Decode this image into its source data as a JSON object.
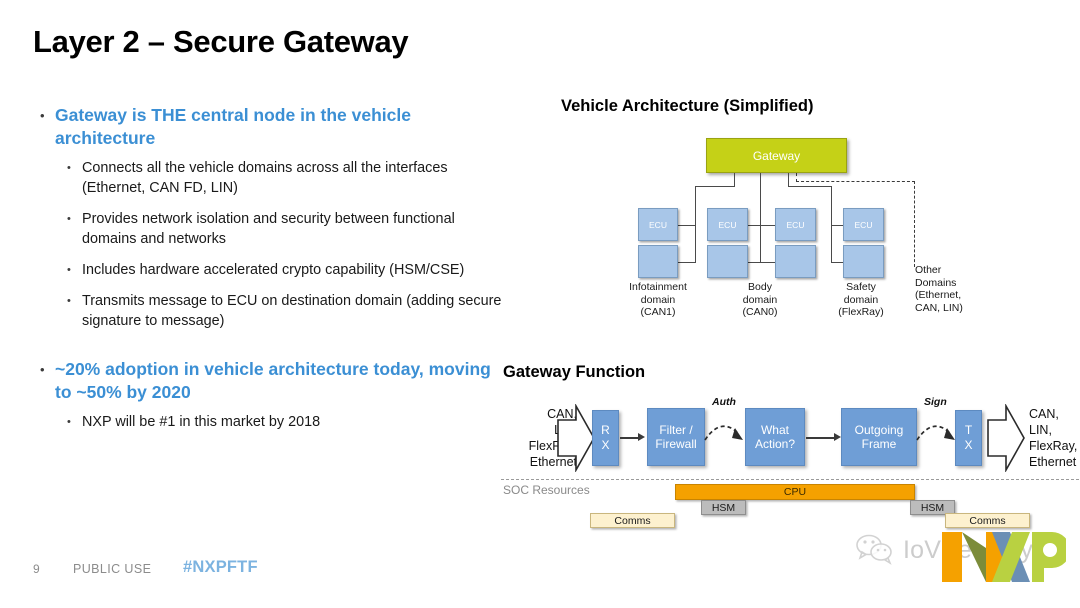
{
  "slide": {
    "title": "Layer 2 – Secure Gateway",
    "accent_blue": "#3b8fd4",
    "gateway_green": "#c5d117",
    "ecu_blue": "#a8c6e8",
    "flow_blue": "#6f9ed6",
    "cpu_orange": "#f5a100"
  },
  "bullets": [
    {
      "level1": "Gateway is THE central node in the vehicle architecture",
      "marker": "•",
      "children": [
        "Connects all the vehicle domains across all the interfaces (Ethernet, CAN FD, LIN)",
        "Provides network isolation and security between functional domains and networks",
        "Includes hardware accelerated crypto capability (HSM/CSE)",
        "Transmits message to ECU on destination domain (adding secure signature to message)"
      ]
    },
    {
      "level1": "~20% adoption in vehicle architecture today, moving to ~50% by 2020",
      "marker": "•",
      "children": [
        "NXP will be #1 in this market by 2018"
      ]
    }
  ],
  "vehicle_architecture": {
    "title": "Vehicle Architecture (Simplified)",
    "gateway_label": "Gateway",
    "ecu_label": "ECU",
    "domains": [
      {
        "name": "Infotainment",
        "line2": "domain",
        "line3": "(CAN1)"
      },
      {
        "name": "Body",
        "line2": "domain",
        "line3": "(CAN0)"
      },
      {
        "name": "Safety",
        "line2": "domain",
        "line3": "(FlexRay)"
      },
      {
        "name": "Other",
        "line2": "Domains",
        "line3": "(Ethernet,",
        "line4": "CAN, LIN)"
      }
    ]
  },
  "gateway_function": {
    "title": "Gateway Function",
    "input_label": "CAN,\nLIN,\nFlexRay,\nEthernet",
    "output_label": "CAN,\nLIN,\nFlexRay,\nEthernet",
    "input_lines": [
      "CAN,",
      "LIN,",
      "FlexRay,",
      "Ethernet"
    ],
    "output_lines": [
      "CAN,",
      "LIN,",
      "FlexRay,",
      "Ethernet"
    ],
    "stages": [
      {
        "id": "rx",
        "label": "R\nX",
        "lines": [
          "R",
          "X"
        ]
      },
      {
        "id": "filter",
        "label": "Filter / Firewall",
        "lines": [
          "Filter /",
          "Firewall"
        ]
      },
      {
        "id": "action",
        "label": "What Action?",
        "lines": [
          "What",
          "Action?"
        ]
      },
      {
        "id": "outgoing",
        "label": "Outgoing Frame",
        "lines": [
          "Outgoing",
          "Frame"
        ]
      },
      {
        "id": "tx",
        "label": "T\nX",
        "lines": [
          "T",
          "X"
        ]
      }
    ],
    "annotations": [
      {
        "id": "auth",
        "label": "Auth"
      },
      {
        "id": "sign",
        "label": "Sign"
      }
    ],
    "soc": {
      "label": "SOC Resources",
      "cpu": "CPU",
      "hsm_left": "HSM",
      "hsm_right": "HSM",
      "comms_left": "Comms",
      "comms_right": "Comms"
    }
  },
  "footer": {
    "page_number": "9",
    "classification": "PUBLIC USE",
    "hashtag": "#NXPFTF"
  },
  "watermark": {
    "text": "IoVSecurity",
    "logo": "NXP"
  }
}
